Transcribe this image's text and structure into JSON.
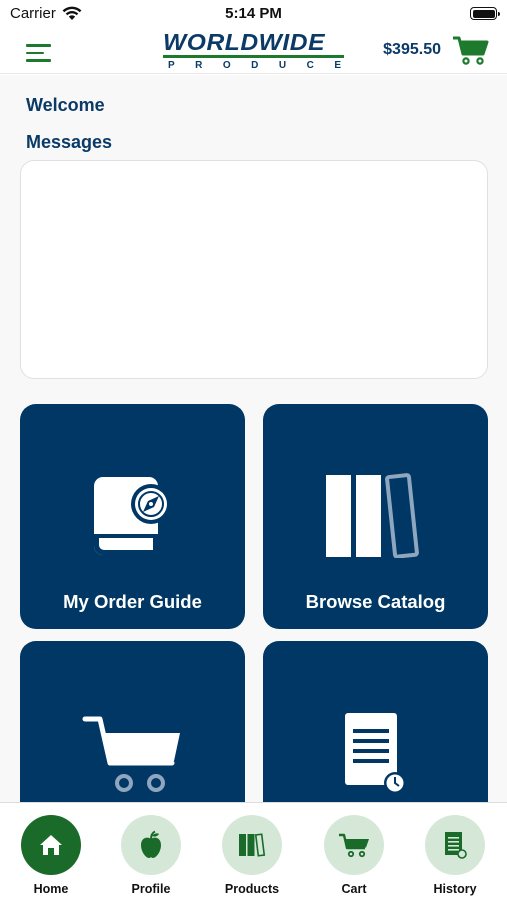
{
  "status_bar": {
    "carrier": "Carrier",
    "time": "5:14 PM"
  },
  "header": {
    "logo_top": "WORLDWIDE",
    "logo_bottom": "PRODUCE",
    "cart_total": "$395.50"
  },
  "main": {
    "welcome": "Welcome",
    "messages_title": "Messages",
    "tiles": [
      {
        "label": "My Order Guide",
        "icon": "order-guide-book-compass-icon"
      },
      {
        "label": "Browse Catalog",
        "icon": "books-catalog-icon"
      },
      {
        "label": "",
        "icon": "shopping-cart-icon"
      },
      {
        "label": "",
        "icon": "document-history-icon"
      }
    ]
  },
  "tabbar": {
    "tabs": [
      {
        "label": "Home",
        "icon": "home-icon",
        "active": true
      },
      {
        "label": "Profile",
        "icon": "apple-icon",
        "active": false
      },
      {
        "label": "Products",
        "icon": "books-icon",
        "active": false
      },
      {
        "label": "Cart",
        "icon": "cart-icon",
        "active": false
      },
      {
        "label": "History",
        "icon": "document-icon",
        "active": false
      }
    ]
  },
  "colors": {
    "navy": "#003764",
    "green": "#1d7a2c",
    "tab_bg": "#d5e8d8",
    "tab_active": "#1a6b2a"
  }
}
